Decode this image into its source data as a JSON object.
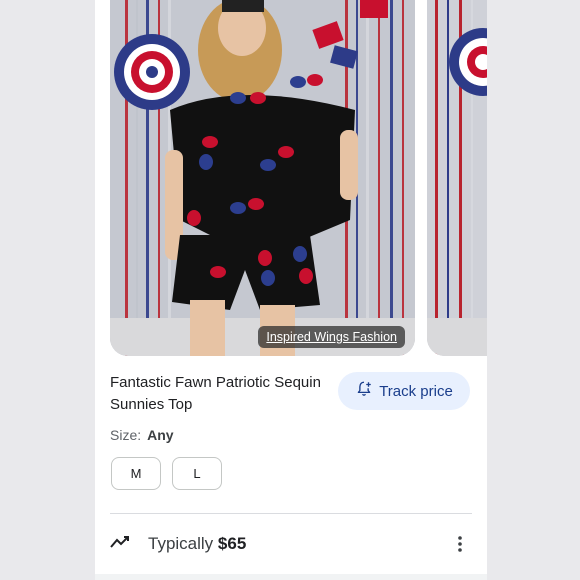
{
  "product": {
    "title": "Fantastic Fawn Patriotic Sequin Sunnies Top",
    "source_label": "Inspired Wings Fashion",
    "track_label": "Track price"
  },
  "size": {
    "label": "Size:",
    "value": "Any",
    "options": [
      "M",
      "L"
    ]
  },
  "price": {
    "label": "Typically",
    "value": "$65"
  },
  "colors": {
    "accent": "#1a3e8c",
    "track_bg": "#e8f0fe",
    "outfit": "#111111",
    "flag_red": "#c8102e",
    "flag_blue": "#2c3e8f"
  },
  "icons": [
    "trend-icon",
    "more-vert-icon",
    "bell-plus-icon"
  ]
}
